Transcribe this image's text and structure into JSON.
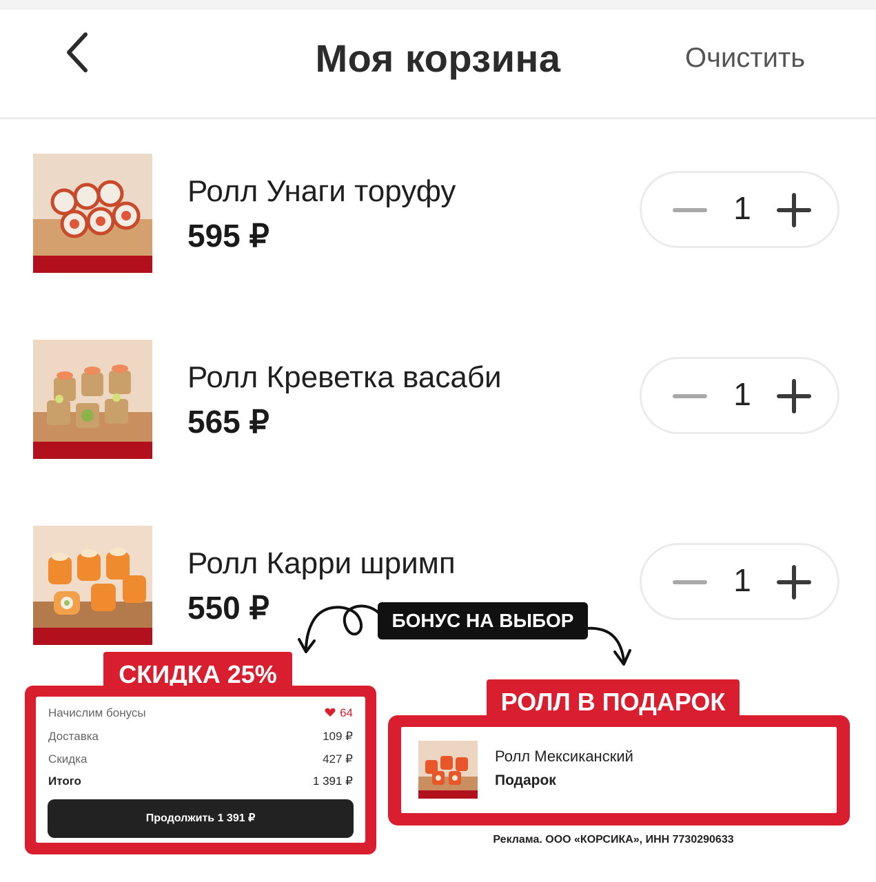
{
  "header": {
    "title": "Моя корзина",
    "clear_label": "Очистить"
  },
  "cart": {
    "items": [
      {
        "name": "Ролл Унаги торуфу",
        "price": "595 ₽",
        "quantity": "1"
      },
      {
        "name": "Ролл Креветка васаби",
        "price": "565 ₽",
        "quantity": "1"
      },
      {
        "name": "Ролл Карри шримп",
        "price": "550 ₽",
        "quantity": "1"
      }
    ]
  },
  "promo": {
    "bonus_label": "БОНУС НА ВЫБОР",
    "discount_label": "СКИДКА 25%",
    "gift_label": "РОЛЛ В ПОДАРОК",
    "ad_text": "Реклама. ООО «КОРСИКА», ИНН 7730290633"
  },
  "summary": {
    "bonus_label": "Начислим бонусы",
    "bonus_value": "64",
    "delivery_label": "Доставка",
    "delivery_value": "109 ₽",
    "discount_label": "Скидка",
    "discount_value": "427 ₽",
    "total_label": "Итого",
    "total_value": "1 391 ₽",
    "continue_label": "Продолжить 1 391 ₽"
  },
  "gift": {
    "name": "Ролл Мексиканский",
    "subtitle": "Подарок"
  },
  "colors": {
    "accent_red": "#d81e2f",
    "dark_button": "#222222",
    "text_primary": "#1f1f1f"
  },
  "icons": [
    "back-arrow-icon",
    "minus-icon",
    "plus-icon",
    "heart-icon",
    "curved-arrow-icon"
  ]
}
